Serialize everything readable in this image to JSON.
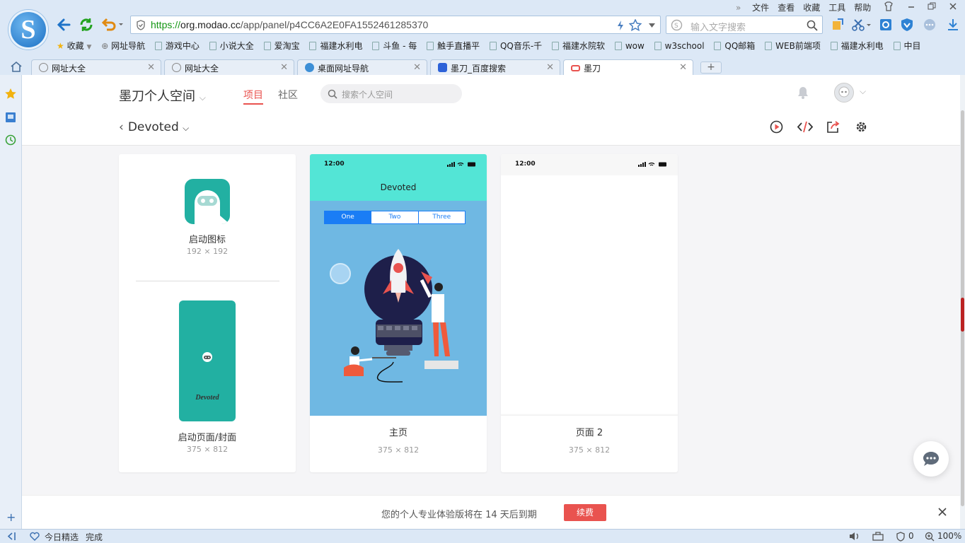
{
  "browser": {
    "url_prefix": "https://",
    "url_host": "org.modao.cc",
    "url_path": "/app/panel/p4CC6A2E0FA1552461285370",
    "search_placeholder": "输入文字搜索",
    "menu": [
      "文件",
      "查看",
      "收藏",
      "工具",
      "帮助"
    ],
    "bookmarks": [
      "收藏",
      "网址导航",
      "游戏中心",
      "小说大全",
      "爱淘宝",
      "福建水利电",
      "斗鱼 - 每",
      "触手直播平",
      "QQ音乐-千",
      "福建水院软",
      "wow",
      "w3school",
      "QQ邮箱",
      "WEB前端项",
      "福建水利电",
      "中目"
    ],
    "tabs": [
      "网址大全",
      "网址大全",
      "桌面网址导航",
      "墨刀_百度搜索",
      "墨刀"
    ],
    "status": {
      "news": "今日精选",
      "state": "完成",
      "count": "0",
      "zoom": "100%"
    }
  },
  "app": {
    "space_title": "墨刀个人空间",
    "nav": [
      "项目",
      "社区"
    ],
    "search_placeholder": "搜索个人空间",
    "project": "Devoted"
  },
  "cards": [
    {
      "launch_icon_label": "启动图标",
      "launch_icon_size": "192 × 192",
      "splash_label": "启动页面/封面",
      "splash_size": "375 × 812",
      "splash_text": "Devoted"
    },
    {
      "time": "12:00",
      "title": "Devoted",
      "segments": [
        "One",
        "Two",
        "Three"
      ],
      "label": "主页",
      "size": "375 × 812"
    },
    {
      "time": "12:00",
      "label": "页面 2",
      "size": "375 × 812"
    }
  ],
  "banner": {
    "message": "您的个人专业体验版将在 14 天后到期",
    "button": "续费"
  },
  "colors": {
    "accent": "#e9534f",
    "teal": "#22b0a2",
    "mint": "#53e5d6",
    "sky": "#6fb8e3",
    "ios_blue": "#1a7df5"
  }
}
